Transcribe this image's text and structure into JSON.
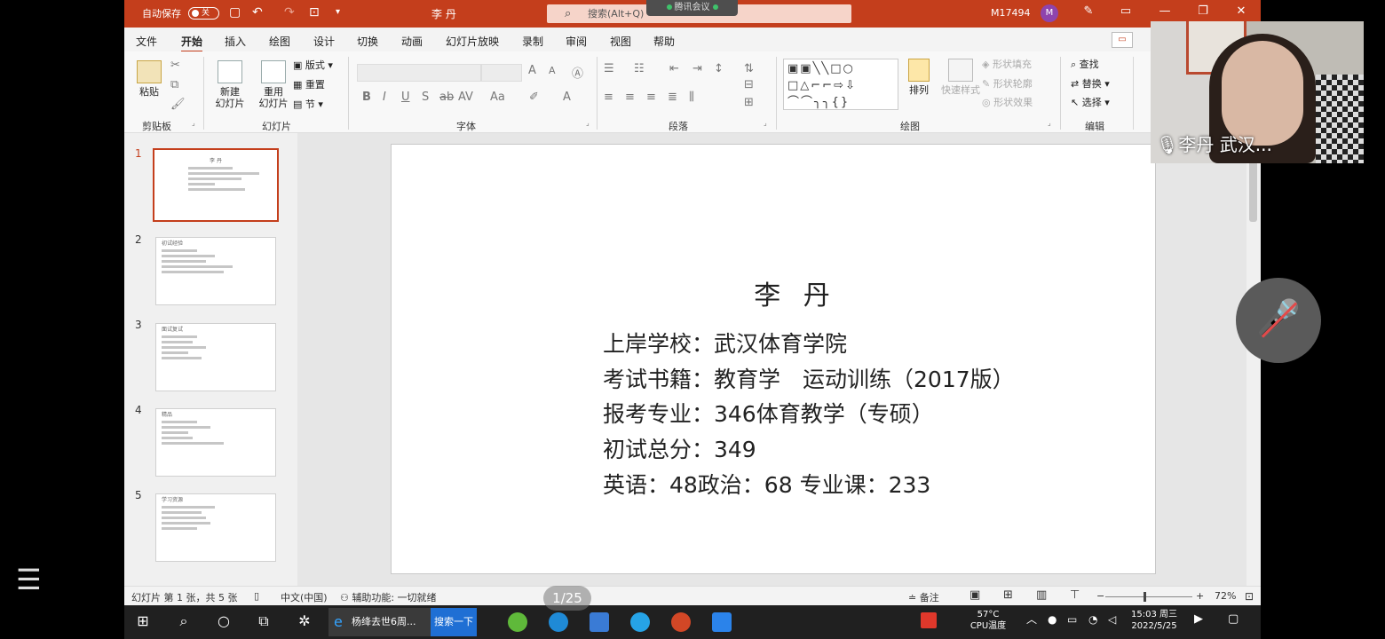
{
  "titlebar": {
    "autosave_label": "自动保存",
    "autosave_state": "关",
    "doc_title": "李 丹",
    "search_placeholder": "搜索(Alt+Q)",
    "meeting_tag": "腾讯会议",
    "user_id": "M17494",
    "avatar_initial": "M"
  },
  "menu": {
    "items": [
      "文件",
      "开始",
      "插入",
      "绘图",
      "设计",
      "切换",
      "动画",
      "幻灯片放映",
      "录制",
      "审阅",
      "视图",
      "帮助"
    ],
    "active": "开始"
  },
  "ribbon": {
    "clipboard": {
      "paste": "粘贴",
      "label": "剪贴板"
    },
    "slides": {
      "new_slide_1": "新建",
      "new_slide_2": "幻灯片",
      "reuse_1": "重用",
      "reuse_2": "幻灯片",
      "layout": "版式",
      "reset": "重置",
      "section": "节",
      "label": "幻灯片"
    },
    "font": {
      "label": "字体"
    },
    "paragraph": {
      "label": "段落"
    },
    "drawing": {
      "arrange": "排列",
      "quick_styles": "快速样式",
      "fill": "形状填充",
      "outline": "形状轮廓",
      "effects": "形状效果",
      "label": "绘图"
    },
    "editing": {
      "find": "查找",
      "replace": "替换",
      "select": "选择",
      "label": "编辑"
    }
  },
  "thumbnails": [
    {
      "num": "1",
      "title": "李 丹"
    },
    {
      "num": "2",
      "title": "初试经验"
    },
    {
      "num": "3",
      "title": "面试复试"
    },
    {
      "num": "4",
      "title": "精品"
    },
    {
      "num": "5",
      "title": "学习资源"
    }
  ],
  "slide": {
    "title": "李 丹",
    "lines": [
      "上岸学校：武汉体育学院",
      "考试书籍：教育学　运动训练（2017版）",
      "报考专业：346体育教学（专硕）",
      "初试总分：349",
      "英语：48政治：68 专业课：233"
    ]
  },
  "statusbar": {
    "slide_info": "幻灯片 第 1 张，共 5 张",
    "language": "中文(中国)",
    "accessibility": "辅助功能: 一切就绪",
    "notes": "备注",
    "zoom": "72%",
    "zoom_fraction": 0.45
  },
  "page_pill": "1/25",
  "taskbar": {
    "ie_title": "杨绛去世6周...",
    "search_btn": "搜索一下",
    "temp": "57°C",
    "temp_label": "CPU温度",
    "time": "15:03 周三",
    "date": "2022/5/25"
  },
  "video": {
    "name": "李丹 武汉..."
  },
  "colors": {
    "accent": "#c43e1c",
    "taskbar": "#202020",
    "search_blue": "#1f6fd4"
  }
}
